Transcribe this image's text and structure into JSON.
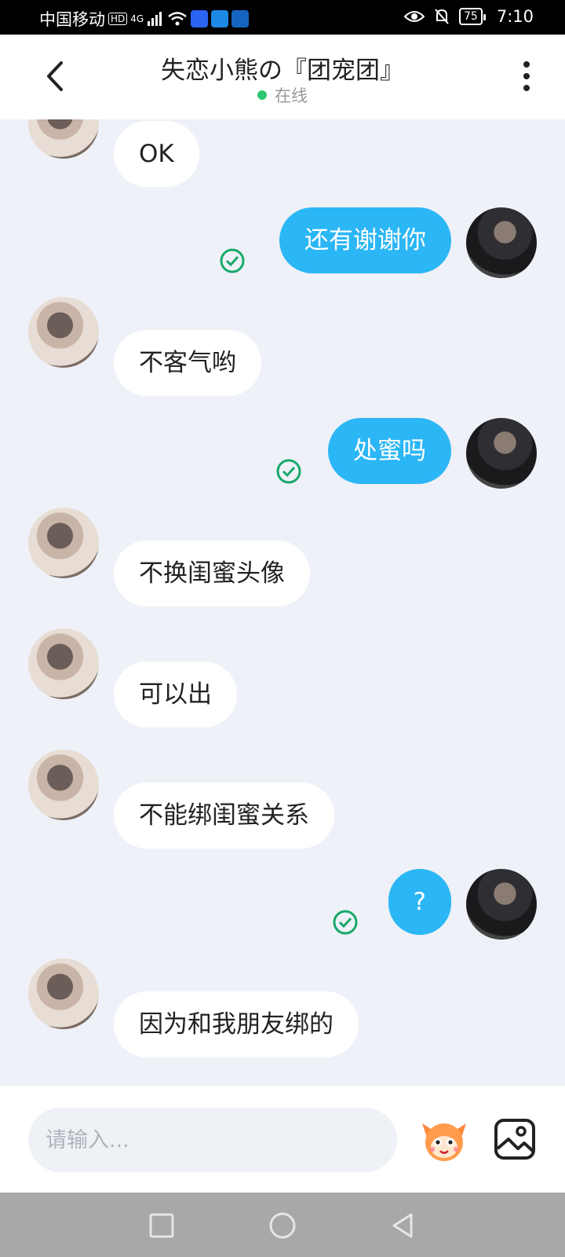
{
  "status_bar": {
    "carrier": "中国移动",
    "hd_badge": "HD",
    "network": "4G",
    "battery": "75",
    "time": "7:10",
    "icons": [
      "signal-icon",
      "wifi-icon",
      "eye-icon",
      "bell-off-icon",
      "battery-icon"
    ]
  },
  "header": {
    "title": "失恋小熊の『团宠团』",
    "presence": "在线",
    "presence_color": "#2ec76f"
  },
  "messages": [
    {
      "side": "in",
      "text": "OK"
    },
    {
      "side": "out",
      "text": "还有谢谢你",
      "read": true
    },
    {
      "side": "in",
      "text": "不客气哟"
    },
    {
      "side": "out",
      "text": "处蜜吗",
      "read": true
    },
    {
      "side": "in",
      "text": "不换闺蜜头像"
    },
    {
      "side": "in",
      "text": "可以出"
    },
    {
      "side": "in",
      "text": "不能绑闺蜜关系"
    },
    {
      "side": "out",
      "text": "?",
      "read": true
    },
    {
      "side": "in",
      "text": "因为和我朋友绑的"
    }
  ],
  "input": {
    "placeholder": "请输入..."
  },
  "colors": {
    "accent": "#2bb6f5",
    "read_check": "#18a86b",
    "background": "#eef1f7"
  }
}
